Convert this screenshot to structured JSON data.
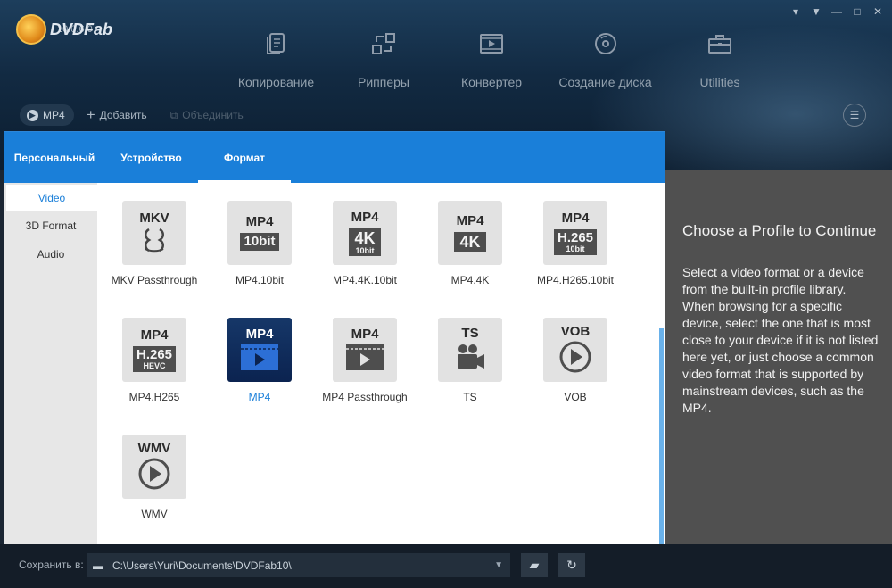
{
  "app": {
    "name": "DVDFab",
    "version": "10.0.6.0"
  },
  "window_controls": [
    "▾",
    "▼",
    "—",
    "□",
    "✕"
  ],
  "nav": [
    {
      "label": "Копирование",
      "icon": "copy-document-icon"
    },
    {
      "label": "Рипперы",
      "icon": "ripper-arrows-icon"
    },
    {
      "label": "Конвертер",
      "icon": "converter-film-icon"
    },
    {
      "label": "Создание диска",
      "icon": "disc-icon"
    },
    {
      "label": "Utilities",
      "icon": "toolbox-icon"
    }
  ],
  "toolbar": {
    "profile": "MP4",
    "add": "Добавить",
    "merge": "Объединить"
  },
  "dialog": {
    "tabs": [
      "Персональный",
      "Устройство",
      "Формат"
    ],
    "active_tab": "Формат",
    "sidebar": [
      "Video",
      "3D Format",
      "Audio"
    ],
    "active_side": "Video",
    "tiles": [
      {
        "label": "MKV Passthrough",
        "top": "MKV",
        "kind": "mkv"
      },
      {
        "label": "MP4.10bit",
        "top": "MP4",
        "badge": "10bit"
      },
      {
        "label": "MP4.4K.10bit",
        "top": "MP4",
        "badge": "4K",
        "badge_sub": "10bit"
      },
      {
        "label": "MP4.4K",
        "top": "MP4",
        "badge": "4K"
      },
      {
        "label": "MP4.H265.10bit",
        "top": "MP4",
        "badge": "H.265",
        "badge_sub": "10bit"
      },
      {
        "label": "MP4.H265",
        "top": "MP4",
        "badge": "H.265",
        "badge_sub": "HEVC"
      },
      {
        "label": "MP4",
        "top": "MP4",
        "kind": "film",
        "selected": true
      },
      {
        "label": "MP4 Passthrough",
        "top": "MP4",
        "kind": "film"
      },
      {
        "label": "TS",
        "top": "TS",
        "kind": "camera"
      },
      {
        "label": "VOB",
        "top": "VOB",
        "kind": "play"
      },
      {
        "label": "WMV",
        "top": "WMV",
        "kind": "play"
      }
    ]
  },
  "info": {
    "title": "Choose a Profile to Continue",
    "text": "Select a video format or a device from the built-in profile library. When browsing for a specific device, select the one that is most close to your device if it is not listed here yet, or just choose a common video format that is supported by mainstream devices, such as the MP4."
  },
  "bottom": {
    "save_label": "Сохранить в:",
    "path": "C:\\Users\\Yuri\\Documents\\DVDFab10\\"
  },
  "colors": {
    "accent": "#1a7fd9",
    "header": "#122a42",
    "panel": "#505050"
  }
}
